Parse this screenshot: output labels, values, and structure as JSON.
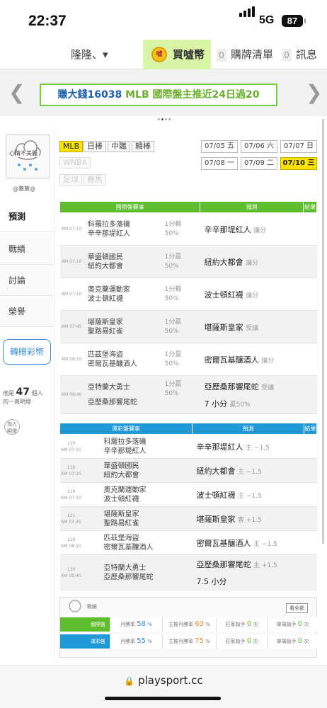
{
  "status": {
    "time": "22:37",
    "network": "5G",
    "battery": "87"
  },
  "topnav": {
    "team": "隆隆、▾",
    "buy": "買噓幣",
    "coin_label": "噓",
    "cart_count": "0",
    "cart": "購牌清單",
    "msg_count": "0",
    "msg": "訊息"
  },
  "banner": {
    "prefix": "賺大錢16038",
    "text": " MLB 國際盤主推近24日過20"
  },
  "profile": {
    "mood": "心情不美麗",
    "name": "@蓋蓋@"
  },
  "sidebar": {
    "items": [
      {
        "label": "預測"
      },
      {
        "label": "戰績"
      },
      {
        "label": "討論"
      },
      {
        "label": "榮譽"
      }
    ],
    "gift": "轉贈彩幣",
    "follow_pre": "他是",
    "follow_count": "47",
    "follow_post": "個人",
    "follow_line2": "的一直明燈",
    "join": "加入明燈"
  },
  "leagues": [
    "MLB",
    "日棒",
    "中職",
    "韓棒",
    "WNBA",
    "足球",
    "賽馬"
  ],
  "dates": [
    "07/05 五",
    "07/06 六",
    "07/07 日",
    "07/08 一",
    "07/09 二",
    "07/10 三"
  ],
  "intl": {
    "headers": [
      "國際盤賽事",
      "預測",
      "結果"
    ],
    "rows": [
      {
        "time": "AM 07:10",
        "away": "科羅拉多落磯",
        "home": "辛辛那堤紅人",
        "line": "1分輸",
        "pct": "50%",
        "pick": "辛辛那堤紅人",
        "tag": "讓分"
      },
      {
        "time": "AM 07:10",
        "away": "華盛頓國民",
        "home": "紐約大都會",
        "line": "1分贏",
        "pct": "50%",
        "pick": "紐約大都會",
        "tag": "讓分"
      },
      {
        "time": "AM 07:10",
        "away": "奧克蘭運動家",
        "home": "波士頓紅襪",
        "line": "1分輸",
        "pct": "50%",
        "pick": "波士頓紅襪",
        "tag": "讓分"
      },
      {
        "time": "AM 07:45",
        "away": "堪薩斯皇家",
        "home": "聖路易紅雀",
        "line": "1分贏",
        "pct": "50%",
        "pick": "堪薩斯皇家",
        "tag": "受讓"
      },
      {
        "time": "AM 08:10",
        "away": "匹茲堡海盜",
        "home": "密爾瓦基釀酒人",
        "line": "1分贏",
        "pct": "50%",
        "pick": "密爾瓦基釀酒人",
        "tag": "讓分"
      },
      {
        "time": "AM 09:40",
        "away": "亞特蘭大勇士",
        "home": "亞歷桑那響尾蛇",
        "line": "1分贏",
        "pct": "50%",
        "pick": "亞歷桑那響尾蛇",
        "tag": "受讓",
        "total": "7 小分",
        "total_tag": "贏50%"
      }
    ]
  },
  "local": {
    "headers": [
      "運彩盤賽事",
      "預測",
      "結果"
    ],
    "rows": [
      {
        "num": "120",
        "time": "AM 07:10",
        "away": "科羅拉多落磯",
        "home": "辛辛那堤紅人",
        "pick": "辛辛那堤紅人",
        "tag": "主 −1.5"
      },
      {
        "num": "119",
        "time": "AM 07:10",
        "away": "華盛頓國民",
        "home": "紐約大都會",
        "pick": "紐約大都會",
        "tag": "主 −1.5"
      },
      {
        "num": "118",
        "time": "AM 07:10",
        "away": "奧克蘭運動家",
        "home": "波士頓紅襪",
        "pick": "波士頓紅襪",
        "tag": "主 −1.5"
      },
      {
        "num": "121",
        "time": "AM 07:45",
        "away": "堪薩斯皇家",
        "home": "聖路易紅雀",
        "pick": "堪薩斯皇家",
        "tag": "客 +1.5"
      },
      {
        "num": "129",
        "time": "AM 08:10",
        "away": "匹茲堡海盜",
        "home": "密爾瓦基釀酒人",
        "pick": "密爾瓦基釀酒人",
        "tag": "主 −1.5"
      },
      {
        "num": "130",
        "time": "AM 09:40",
        "away": "亞特蘭大勇士",
        "home": "亞歷桑那響尾蛇",
        "pick": "亞歷桑那響尾蛇",
        "tag": "主 +1.5",
        "total": "7.5 小分"
      }
    ]
  },
  "stats": {
    "title": "戰績",
    "view_all": "看全部",
    "rows": [
      {
        "label": "國際盤",
        "color": "#5ebd2c",
        "cells": [
          {
            "pre": "月勝率",
            "val": "58",
            "post": "%",
            "color": "#3a8fd6"
          },
          {
            "pre": "主推月勝率",
            "val": "63",
            "post": "%",
            "color": "#f08a24"
          },
          {
            "pre": "莊家殺手",
            "val": "0",
            "post": "次",
            "color": "#5ebd2c"
          },
          {
            "pre": "單場殺手",
            "val": "0",
            "post": "次",
            "color": "#5ebd2c"
          }
        ]
      },
      {
        "label": "運彩盤",
        "color": "#1f9ad6",
        "cells": [
          {
            "pre": "月勝率",
            "val": "55",
            "post": "%",
            "color": "#3a8fd6"
          },
          {
            "pre": "主推月勝率",
            "val": "75",
            "post": "%",
            "color": "#f08a24"
          },
          {
            "pre": "莊家殺手",
            "val": "0",
            "post": "次",
            "color": "#5ebd2c"
          },
          {
            "pre": "單場殺手",
            "val": "0",
            "post": "次",
            "color": "#5ebd2c"
          }
        ]
      }
    ]
  },
  "url": "playsport.cc"
}
